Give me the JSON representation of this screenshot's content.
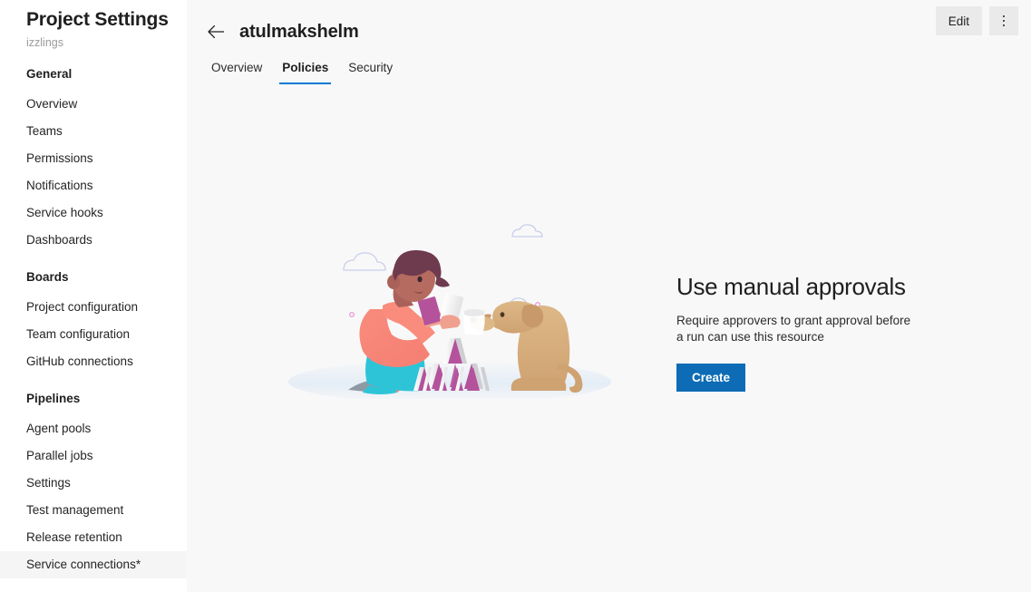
{
  "sidebar": {
    "title": "Project Settings",
    "subtitle": "izzlings",
    "groups": [
      {
        "header": "General",
        "items": [
          {
            "label": "Overview",
            "selected": false
          },
          {
            "label": "Teams",
            "selected": false
          },
          {
            "label": "Permissions",
            "selected": false
          },
          {
            "label": "Notifications",
            "selected": false
          },
          {
            "label": "Service hooks",
            "selected": false
          },
          {
            "label": "Dashboards",
            "selected": false
          }
        ]
      },
      {
        "header": "Boards",
        "items": [
          {
            "label": "Project configuration",
            "selected": false
          },
          {
            "label": "Team configuration",
            "selected": false
          },
          {
            "label": "GitHub connections",
            "selected": false
          }
        ]
      },
      {
        "header": "Pipelines",
        "items": [
          {
            "label": "Agent pools",
            "selected": false
          },
          {
            "label": "Parallel jobs",
            "selected": false
          },
          {
            "label": "Settings",
            "selected": false
          },
          {
            "label": "Test management",
            "selected": false
          },
          {
            "label": "Release retention",
            "selected": false
          },
          {
            "label": "Service connections*",
            "selected": true
          }
        ]
      }
    ],
    "scrollbar": {
      "up_arrow_icon": "chevron-up-icon"
    }
  },
  "header": {
    "back_icon": "arrow-left-icon",
    "title": "atulmakshelm",
    "edit_label": "Edit",
    "more_icon": "more-vertical-icon"
  },
  "tabs": [
    {
      "label": "Overview",
      "active": false
    },
    {
      "label": "Policies",
      "active": true
    },
    {
      "label": "Security",
      "active": false
    }
  ],
  "empty_state": {
    "illustration_name": "person-building-card-tower-with-dog-illustration",
    "title": "Use manual approvals",
    "description": "Require approvers to grant approval before a run can use this resource",
    "create_label": "Create"
  },
  "colors": {
    "accent_blue": "#0078d4",
    "primary_button": "#0d6cb5",
    "content_bg": "#f8f8f8",
    "sidebar_bg": "#ffffff",
    "selected_row": "#f5f5f5",
    "scrollbar_thumb": "#bdbdbd",
    "subtitle_gray": "#9a9a9a"
  }
}
